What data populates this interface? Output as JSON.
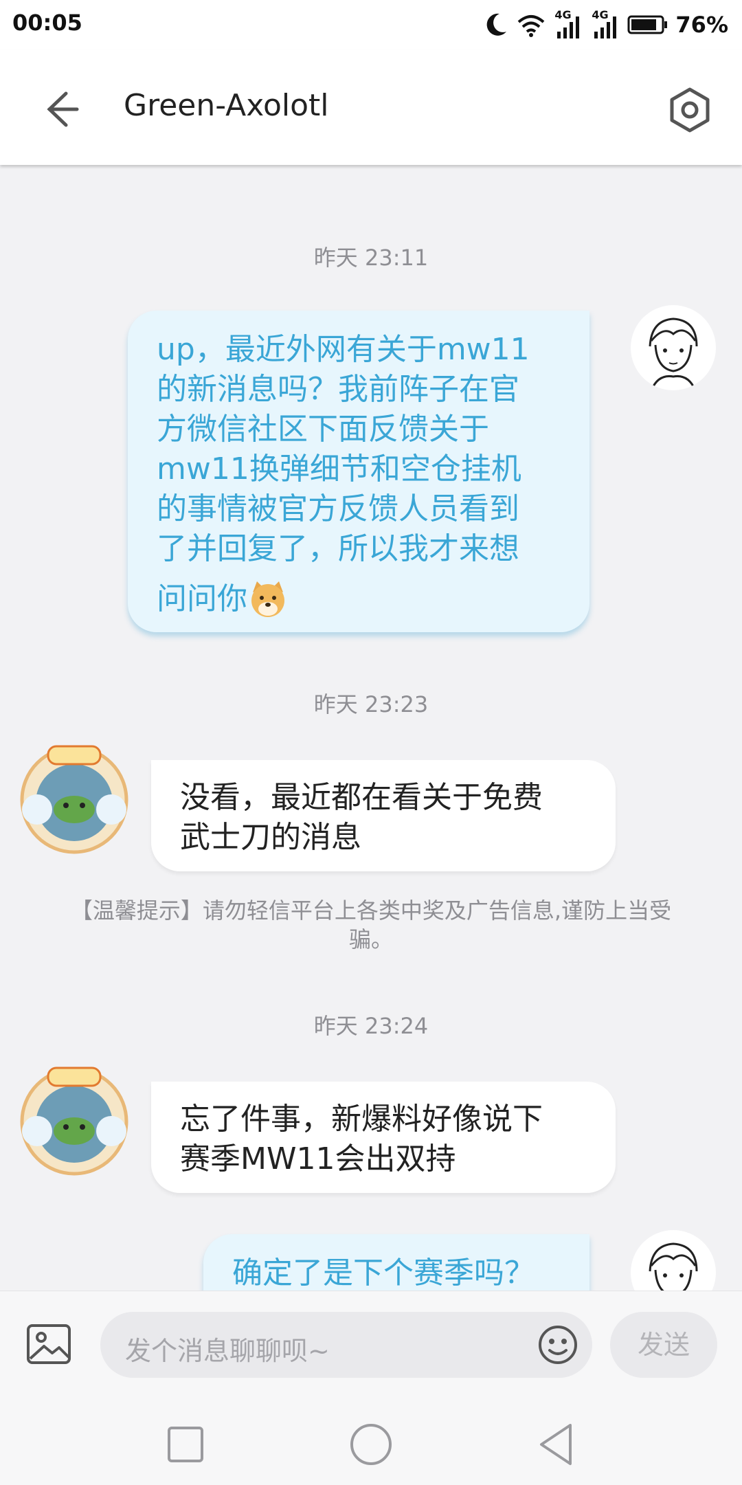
{
  "status_bar": {
    "time": "00:05",
    "network1": "4G",
    "network2": "4G",
    "battery": "76%"
  },
  "header": {
    "title": "Green-Axolotl"
  },
  "messages": [
    {
      "timestamp": "昨天 23:11",
      "lines": [
        "up，最近外网有关于mw11",
        "的新消息吗？我前阵子在官",
        "方微信社区下面反馈关于",
        "mw11换弹细节和空仓挂机",
        "的事情被官方反馈人员看到",
        "了并回复了，所以我才来想",
        "问问你"
      ],
      "emoji": "doge-emoji"
    },
    {
      "timestamp": "昨天 23:23",
      "lines": [
        "没看，最近都在看关于免费",
        "武士刀的消息"
      ]
    },
    {
      "notice": "【温馨提示】请勿轻信平台上各类中奖及广告信息,谨防上当受骗。"
    },
    {
      "timestamp": "昨天 23:24",
      "lines": [
        "忘了件事，新爆料好像说下",
        "赛季MW11会出双持"
      ]
    },
    {
      "lines": [
        "确定了是下个赛季吗？"
      ]
    }
  ],
  "input": {
    "placeholder": "发个消息聊聊呗~",
    "send_label": "发送"
  },
  "colors": {
    "outgoing_text": "#3aa6d6",
    "outgoing_bg": "#e7f6fd",
    "incoming_bg": "#ffffff",
    "background": "#f2f2f4"
  }
}
